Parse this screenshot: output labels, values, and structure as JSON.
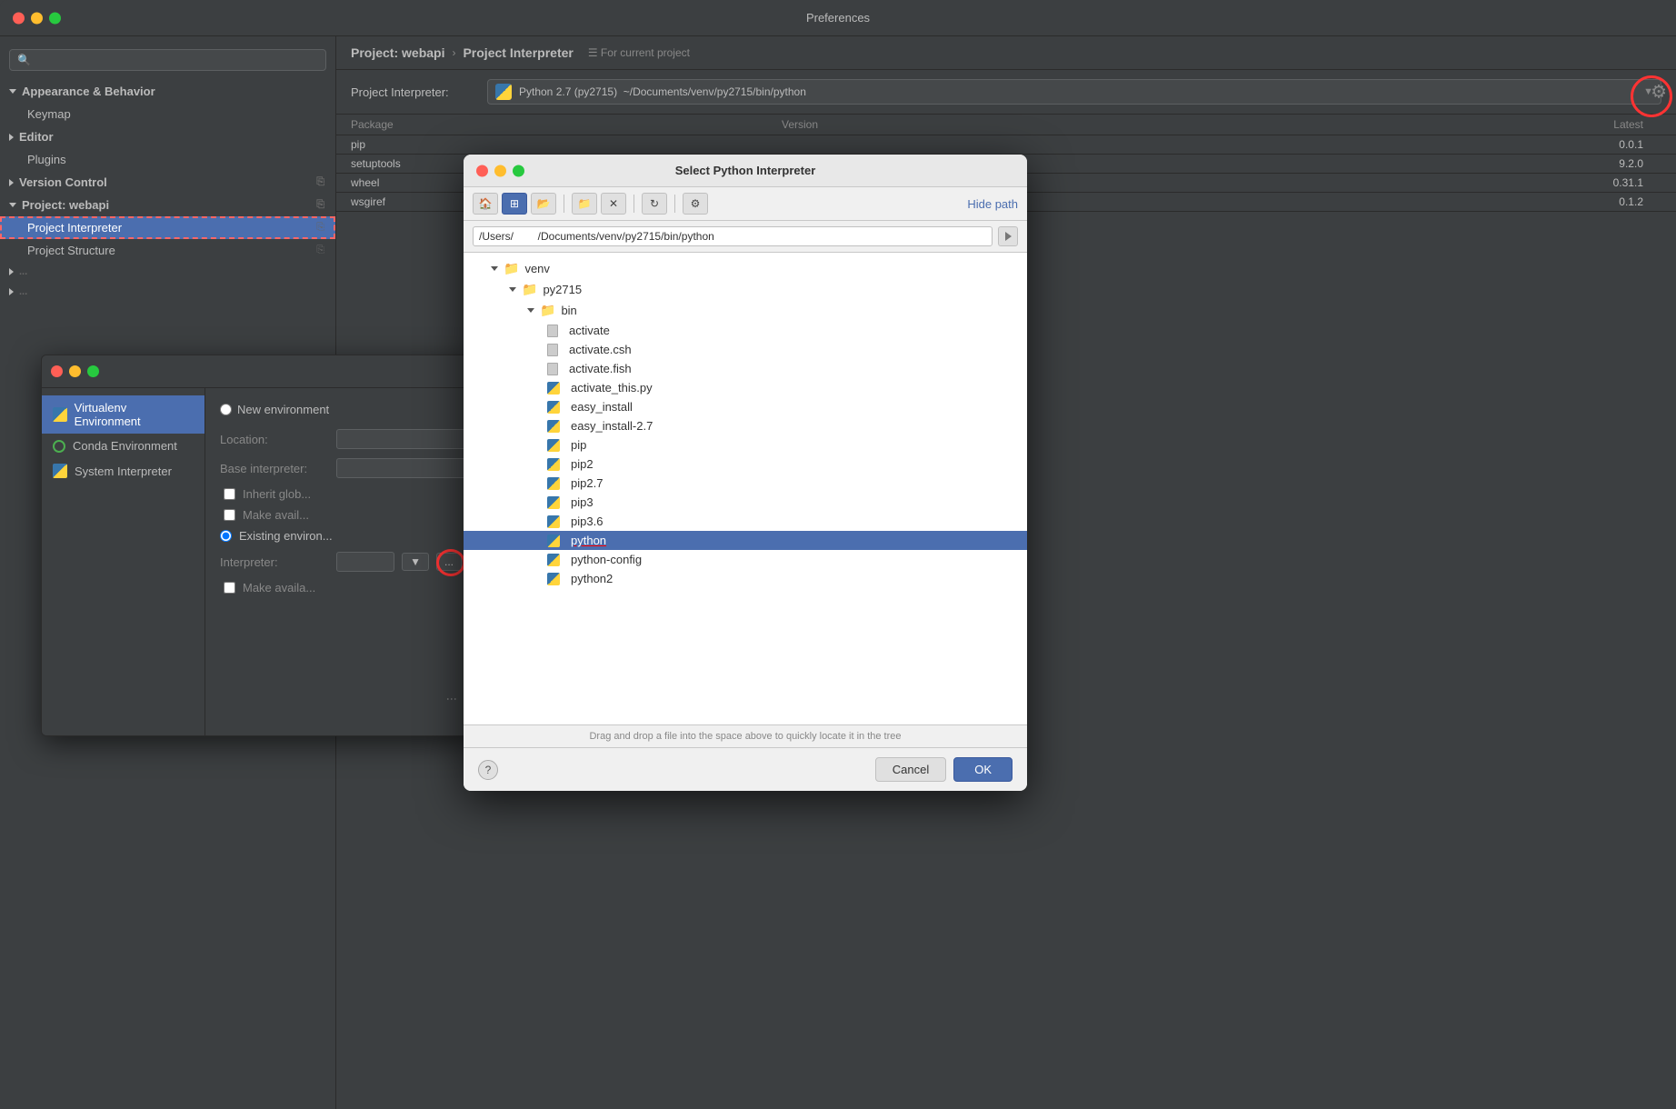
{
  "window": {
    "title": "Preferences"
  },
  "sidebar": {
    "search_placeholder": "🔍",
    "items": [
      {
        "id": "appearance",
        "label": "Appearance & Behavior",
        "level": "parent",
        "expanded": true
      },
      {
        "id": "keymap",
        "label": "Keymap",
        "level": "top"
      },
      {
        "id": "editor",
        "label": "Editor",
        "level": "parent-collapsed"
      },
      {
        "id": "plugins",
        "label": "Plugins",
        "level": "top"
      },
      {
        "id": "version-control",
        "label": "Version Control",
        "level": "parent-collapsed"
      },
      {
        "id": "project-webapi",
        "label": "Project: webapi",
        "level": "parent-expanded"
      },
      {
        "id": "project-interpreter",
        "label": "Project Interpreter",
        "level": "child",
        "selected": true
      },
      {
        "id": "project-structure",
        "label": "Project Structure",
        "level": "child"
      }
    ]
  },
  "main_panel": {
    "breadcrumb": {
      "project": "Project: webapi",
      "separator": "›",
      "current": "Project Interpreter",
      "hint": "☰ For current project"
    },
    "interpreter_label": "Project Interpreter:",
    "interpreter_value": "🐍 Python 2.7 (py2715)  ~/Documents/venv/py2715/bin/python",
    "table_headers": [
      "Package",
      "Version",
      "Latest"
    ],
    "packages": [
      {
        "name": "pip",
        "version": "",
        "latest": "0.0.1"
      },
      {
        "name": "setuptools",
        "version": "",
        "latest": "9.2.0"
      },
      {
        "name": "wheel",
        "version": "",
        "latest": "0.31.1"
      },
      {
        "name": "wsgiref",
        "version": "",
        "latest": "0.1.2"
      }
    ]
  },
  "add_interpreter_dialog": {
    "sidebar_items": [
      {
        "id": "virtualenv",
        "label": "Virtualenv Environment",
        "selected": true
      },
      {
        "id": "conda",
        "label": "Conda Environment"
      },
      {
        "id": "system",
        "label": "System Interpreter"
      }
    ],
    "radio_new": "New environment",
    "radio_existing": "Existing environment",
    "location_label": "Location:",
    "base_interpreter_label": "Base interpreter:",
    "inherit_global_label": "Inherit glob...",
    "make_available_label": "Make avail...",
    "existing_env_label": "Existing environ...",
    "interpreter_label": "Interpreter:",
    "make_available2_label": "Make availa..."
  },
  "file_dialog": {
    "title": "Select Python Interpreter",
    "toolbar_buttons": [
      "home",
      "grid",
      "folder-open",
      "folder-new",
      "close",
      "refresh",
      "options"
    ],
    "hide_path_label": "Hide path",
    "path_value": "/Users/        /Documents/venv/py2715/bin/python",
    "tree_items": [
      {
        "id": "venv",
        "label": "venv",
        "type": "folder",
        "level": 0,
        "expanded": true
      },
      {
        "id": "py2715",
        "label": "py2715",
        "type": "folder",
        "level": 1,
        "expanded": true
      },
      {
        "id": "bin",
        "label": "bin",
        "type": "folder",
        "level": 2,
        "expanded": true
      },
      {
        "id": "activate",
        "label": "activate",
        "type": "file",
        "level": 3
      },
      {
        "id": "activate_csh",
        "label": "activate.csh",
        "type": "file",
        "level": 3
      },
      {
        "id": "activate_fish",
        "label": "activate.fish",
        "type": "file",
        "level": 3
      },
      {
        "id": "activate_this_py",
        "label": "activate_this.py",
        "type": "py",
        "level": 3
      },
      {
        "id": "easy_install",
        "label": "easy_install",
        "type": "py",
        "level": 3
      },
      {
        "id": "easy_install_27",
        "label": "easy_install-2.7",
        "type": "py",
        "level": 3
      },
      {
        "id": "pip_file",
        "label": "pip",
        "type": "py",
        "level": 3
      },
      {
        "id": "pip2",
        "label": "pip2",
        "type": "py",
        "level": 3
      },
      {
        "id": "pip27",
        "label": "pip2.7",
        "type": "py",
        "level": 3
      },
      {
        "id": "pip3",
        "label": "pip3",
        "type": "py",
        "level": 3
      },
      {
        "id": "pip36",
        "label": "pip3.6",
        "type": "py",
        "level": 3
      },
      {
        "id": "python",
        "label": "python",
        "type": "py",
        "level": 3,
        "selected": true
      },
      {
        "id": "python_config",
        "label": "python-config",
        "type": "py",
        "level": 3
      },
      {
        "id": "python2",
        "label": "python2",
        "type": "py",
        "level": 3
      }
    ],
    "status_text": "Drag and drop a file into the space above to quickly locate it in the tree",
    "help_label": "?",
    "cancel_label": "Cancel",
    "ok_label": "OK"
  }
}
